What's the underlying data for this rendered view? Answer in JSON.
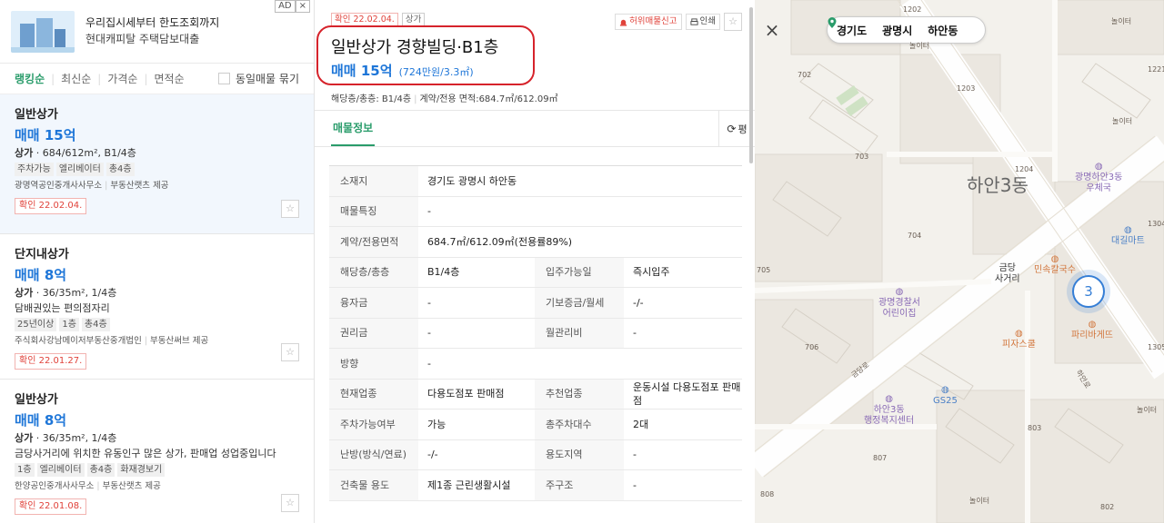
{
  "ad": {
    "line1": "우리집시세부터 한도조회까지",
    "line2": "현대캐피탈 주택담보대출",
    "badge": "AD",
    "close": "×"
  },
  "sort": {
    "options": [
      "랭킹순",
      "최신순",
      "가격순",
      "면적순"
    ],
    "group_label": "동일매물 묶기"
  },
  "listings": [
    {
      "name": "일반상가",
      "price": "매매 15억",
      "spec_type": "상가",
      "spec_rest": " · 684/612m², B1/4층",
      "desc": "",
      "tags": [
        "주차가능",
        "엘리베이터",
        "총4층"
      ],
      "agent": "광명역공인중개사사무소",
      "provider": "부동산랫츠 제공",
      "confirmed": "확인 22.02.04."
    },
    {
      "name": "단지내상가",
      "price": "매매 8억",
      "spec_type": "상가",
      "spec_rest": " · 36/35m², 1/4층",
      "desc": "담배권있는 편의점자리",
      "tags": [
        "25년이상",
        "1층",
        "총4층"
      ],
      "agent": "주식회사강남메이저부동산중개법인",
      "provider": "부동산써브 제공",
      "confirmed": "확인 22.01.27."
    },
    {
      "name": "일반상가",
      "price": "매매 8억",
      "spec_type": "상가",
      "spec_rest": " · 36/35m², 1/4층",
      "desc": "금당사거리에 위치한 유동인구 많은 상가, 판매업 성업중입니다",
      "tags": [
        "1층",
        "엘리베이터",
        "총4층",
        "화재경보기"
      ],
      "agent": "한양공인중개사사무소",
      "provider": "부동산랫츠 제공",
      "confirmed": "확인 22.01.08."
    }
  ],
  "detail": {
    "confirm_chip": "확인 22.02.04.",
    "type_chip": "상가",
    "report_label": "허위매물신고",
    "print_label": "인쇄",
    "title": "일반상가 경향빌딩·B1층",
    "price": "매매 15억",
    "unit_price": "(724만원/3.3㎡)",
    "summary_floor": "해당층/총층: B1/4층",
    "summary_area": "계약/전용 면적:684.7㎡/612.09㎡",
    "tab": "매물정보",
    "unit_toggle": "평",
    "rows": [
      {
        "k1": "소재지",
        "v1": "경기도 광명시 하안동",
        "k2": "",
        "v2": "",
        "span": true
      },
      {
        "k1": "매물특징",
        "v1": "-",
        "k2": "",
        "v2": "",
        "span": true
      },
      {
        "k1": "계약/전용면적",
        "v1": "684.7㎡/612.09㎡(전용률89%)",
        "k2": "",
        "v2": "",
        "span": true
      },
      {
        "k1": "해당층/총층",
        "v1": "B1/4층",
        "k2": "입주가능일",
        "v2": "즉시입주",
        "span": false
      },
      {
        "k1": "융자금",
        "v1": "-",
        "k2": "기보증금/월세",
        "v2": "-/-",
        "span": false
      },
      {
        "k1": "권리금",
        "v1": "-",
        "k2": "월관리비",
        "v2": "-",
        "span": false
      },
      {
        "k1": "방향",
        "v1": "-",
        "k2": "",
        "v2": "",
        "span": true
      },
      {
        "k1": "현재업종",
        "v1": "다용도점포 판매점",
        "k2": "추천업종",
        "v2": "운동시설 다용도점포 판매점",
        "span": false
      },
      {
        "k1": "주차가능여부",
        "v1": "가능",
        "k2": "총주차대수",
        "v2": "2대",
        "span": false
      },
      {
        "k1": "난방(방식/연료)",
        "v1": "-/-",
        "k2": "용도지역",
        "v2": "-",
        "span": false
      },
      {
        "k1": "건축물 용도",
        "v1": "제1종 근린생활시설",
        "k2": "주구조",
        "v2": "-",
        "span": false
      }
    ]
  },
  "map": {
    "close": "×",
    "location": [
      "경기도",
      "광명시",
      "하안동"
    ],
    "district": "하안3동",
    "cluster_count": "3",
    "labels": {
      "n1202": "1202",
      "n702": "702",
      "n1203": "1203",
      "n1204": "1204",
      "n703": "703",
      "n704": "704",
      "n705": "705",
      "n706": "706",
      "n803": "803",
      "n807": "807",
      "n808": "808",
      "n802": "802",
      "n1221": "1221",
      "n1304": "1304",
      "n1305": "1305",
      "play1": "놀이터",
      "play2": "놀이터",
      "play3": "놀이터",
      "play4": "놀이터",
      "play5": "놀이터",
      "road1": "금당로",
      "road2": "하안로"
    },
    "pois": {
      "post": "광명하안3동\n우체국",
      "mart": "대길마트",
      "intersection": "금당\n사거리",
      "noodle": "민속칼국수",
      "daycare": "광명경찰서\n어린이집",
      "pizza": "피자스쿨",
      "bakery": "파리바게뜨",
      "gs": "GS25",
      "center": "하안3동\n행정복지센터"
    }
  },
  "colors": {
    "accent_green": "#2a9c6b",
    "price_blue": "#1e76d8",
    "confirm_red": "#e0423a",
    "highlight_circle": "#d6232b"
  }
}
